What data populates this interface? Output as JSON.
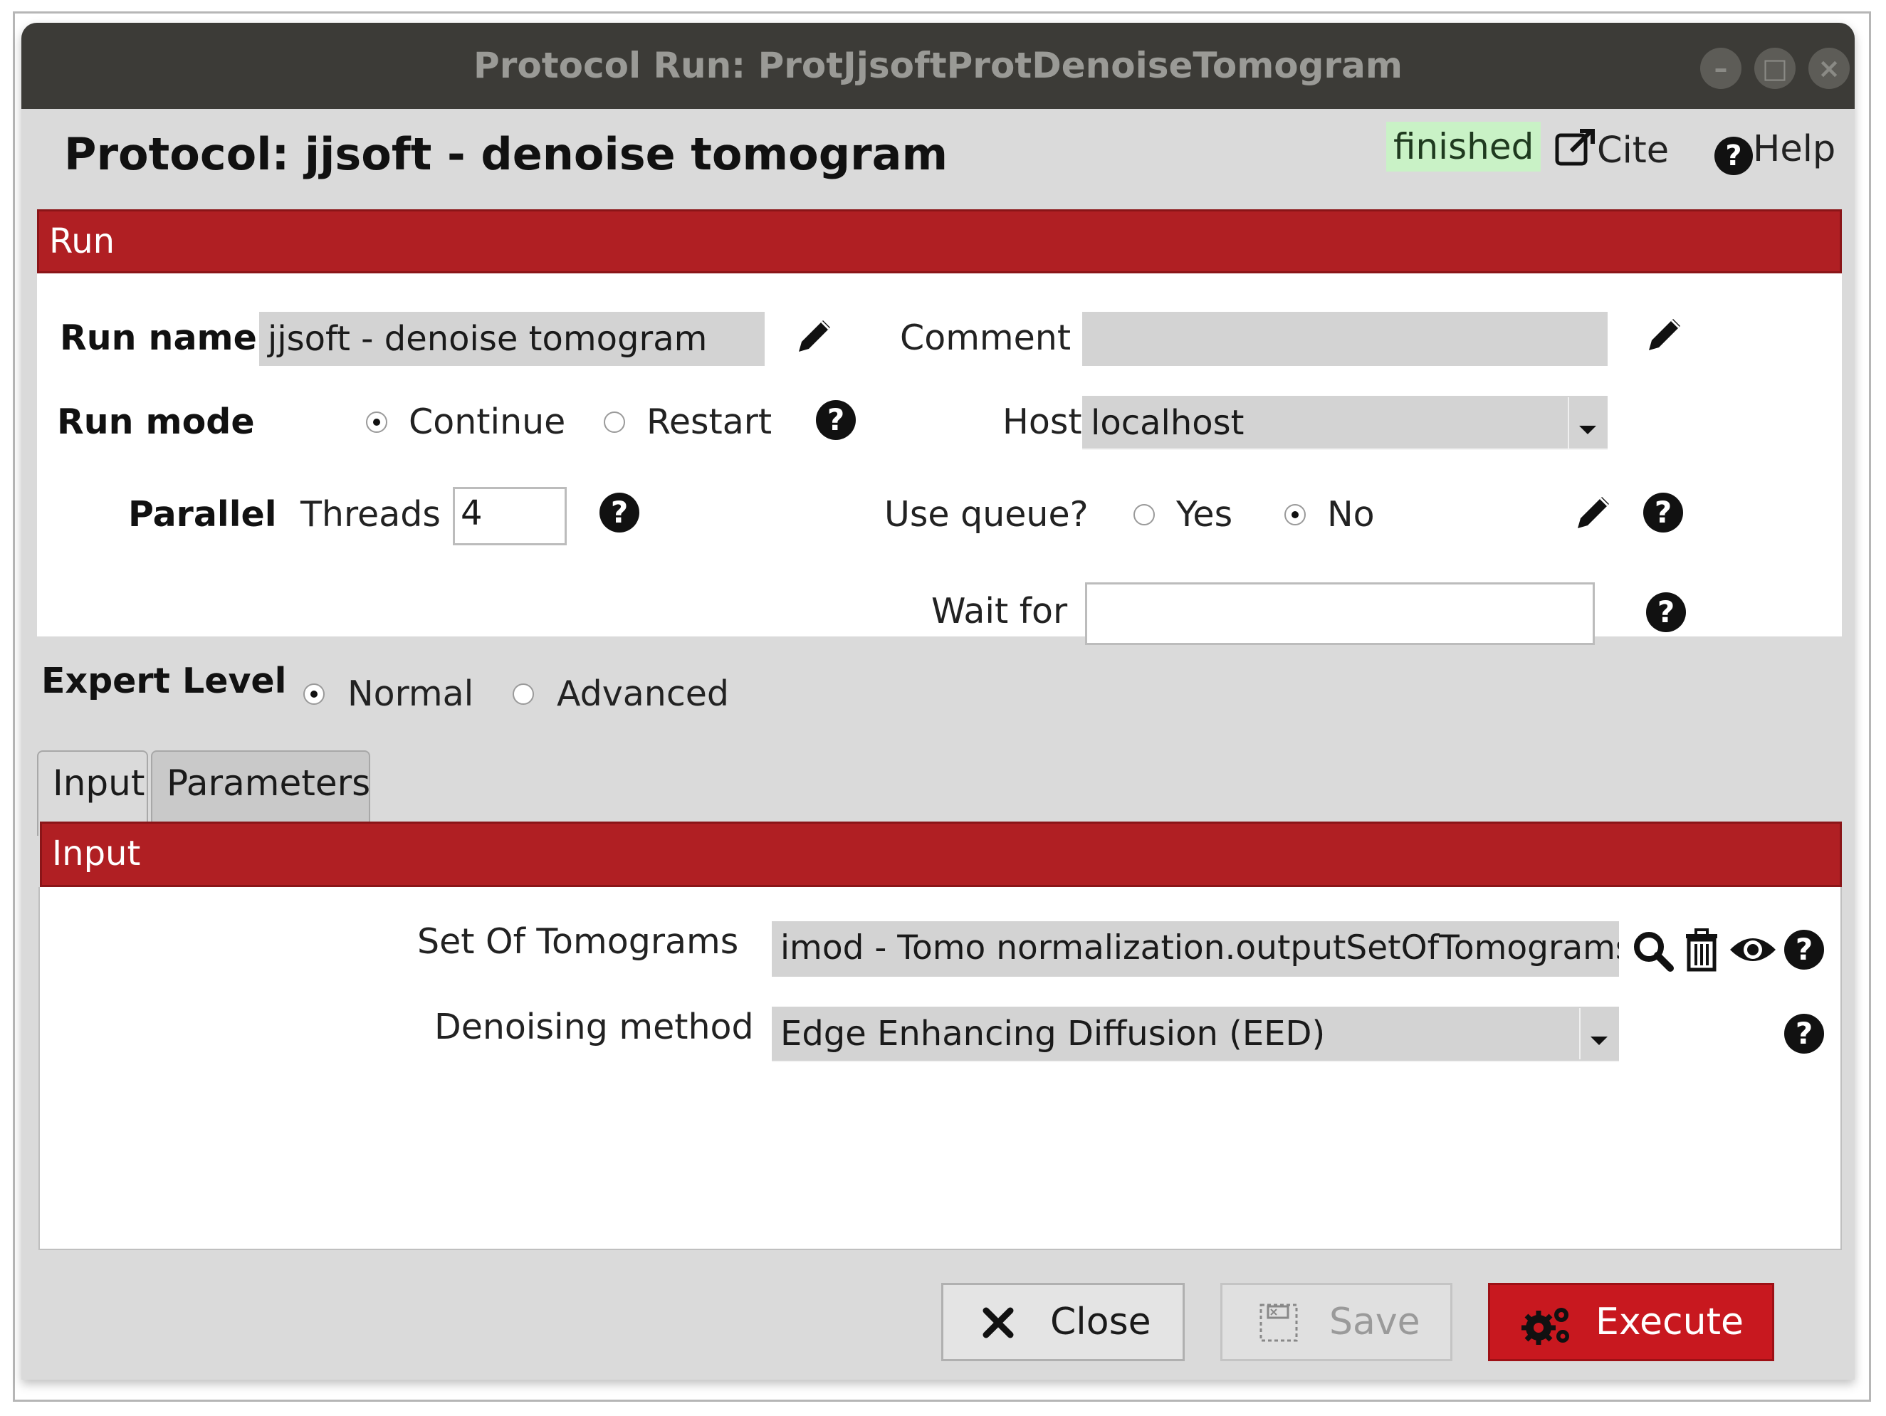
{
  "window": {
    "title": "Protocol Run: ProtJjsoftProtDenoiseTomogram"
  },
  "header": {
    "protocol_title": "Protocol: jjsoft - denoise tomogram",
    "status": "finished",
    "cite_label": "Cite",
    "help_label": "Help"
  },
  "run_section": {
    "title": "Run",
    "run_name_label": "Run name",
    "run_name_value": "jjsoft - denoise tomogram",
    "comment_label": "Comment",
    "comment_value": "",
    "run_mode_label": "Run mode",
    "run_mode_options": [
      "Continue",
      "Restart"
    ],
    "run_mode_selected": "Continue",
    "host_label": "Host",
    "host_value": "localhost",
    "parallel_label": "Parallel",
    "threads_label": "Threads",
    "threads_value": "4",
    "use_queue_label": "Use queue?",
    "use_queue_options": [
      "Yes",
      "No"
    ],
    "use_queue_selected": "No",
    "wait_for_label": "Wait for",
    "wait_for_value": ""
  },
  "expert_level": {
    "label": "Expert Level",
    "options": [
      "Normal",
      "Advanced"
    ],
    "selected": "Normal"
  },
  "tabs": [
    {
      "label": "Input",
      "active": true
    },
    {
      "label": "Parameters",
      "active": false
    }
  ],
  "input_section": {
    "title": "Input",
    "set_of_tomograms_label": "Set Of Tomograms",
    "set_of_tomograms_value": "imod - Tomo normalization.outputSetOfTomograms",
    "denoising_method_label": "Denoising method",
    "denoising_method_value": "Edge Enhancing Diffusion (EED)"
  },
  "footer": {
    "close_label": "Close",
    "save_label": "Save",
    "execute_label": "Execute"
  },
  "colors": {
    "accent_red": "#b01f23",
    "status_green": "#c9f2c6",
    "titlebar": "#3c3b37"
  }
}
